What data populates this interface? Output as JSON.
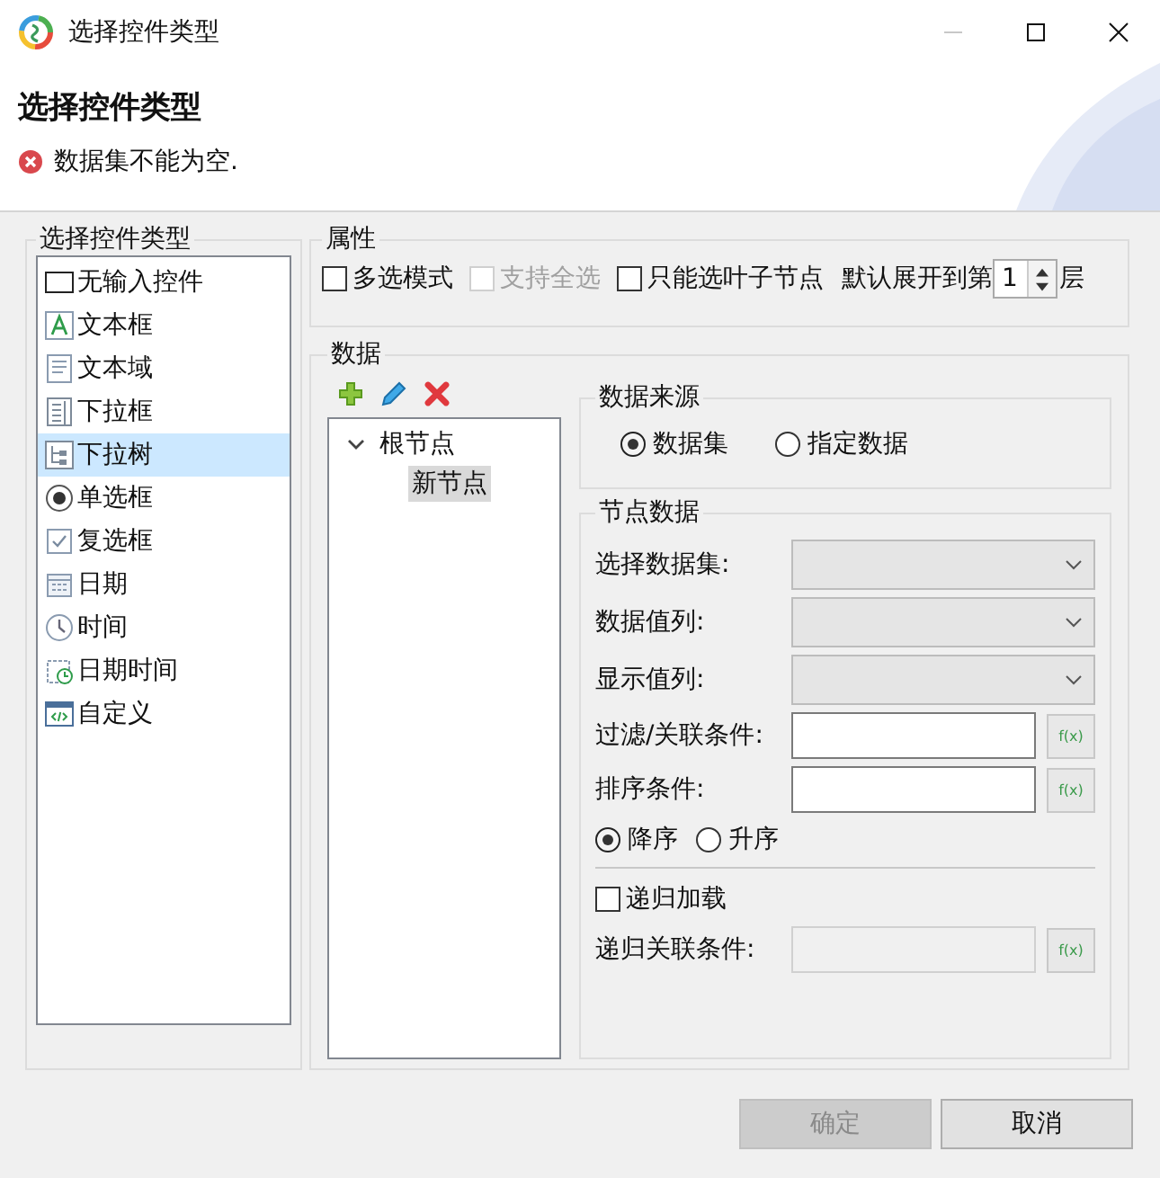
{
  "window": {
    "title": "选择控件类型",
    "buttons": [
      {
        "kind": "minimize",
        "disabled": true
      },
      {
        "kind": "maximize",
        "disabled": false
      },
      {
        "kind": "close",
        "disabled": false
      }
    ]
  },
  "header": {
    "title": "选择控件类型",
    "message": "数据集不能为空."
  },
  "control_types": {
    "title": "选择控件类型",
    "items": [
      {
        "label": "无输入控件",
        "kind": "none",
        "selected": false
      },
      {
        "label": "文本框",
        "kind": "textbox",
        "selected": false
      },
      {
        "label": "文本域",
        "kind": "textarea",
        "selected": false
      },
      {
        "label": "下拉框",
        "kind": "combo",
        "selected": false
      },
      {
        "label": "下拉树",
        "kind": "tree",
        "selected": true
      },
      {
        "label": "单选框",
        "kind": "radio",
        "selected": false
      },
      {
        "label": "复选框",
        "kind": "checkbox",
        "selected": false
      },
      {
        "label": "日期",
        "kind": "date",
        "selected": false
      },
      {
        "label": "时间",
        "kind": "time",
        "selected": false
      },
      {
        "label": "日期时间",
        "kind": "datetime",
        "selected": false
      },
      {
        "label": "自定义",
        "kind": "custom",
        "selected": false
      }
    ]
  },
  "properties": {
    "title": "属性",
    "options": [
      {
        "label": "多选模式",
        "checked": false,
        "disabled": false
      },
      {
        "label": "支持全选",
        "checked": false,
        "disabled": true
      },
      {
        "label": "只能选叶子节点",
        "checked": false,
        "disabled": false
      }
    ],
    "expand_label": "默认展开到第",
    "expand_value": "1",
    "expand_suffix": "层"
  },
  "data": {
    "title": "数据",
    "toolbar": [
      {
        "kind": "add"
      },
      {
        "kind": "edit"
      },
      {
        "kind": "delete"
      }
    ],
    "tree": [
      {
        "label": "根节点",
        "expanded": true,
        "selected": false,
        "children": [
          {
            "label": "新节点",
            "selected": true
          }
        ]
      }
    ],
    "source": {
      "title": "数据来源",
      "options": [
        {
          "label": "数据集",
          "selected": true
        },
        {
          "label": "指定数据",
          "selected": false
        }
      ]
    },
    "node_data": {
      "title": "节点数据",
      "fields": [
        {
          "label": "选择数据集:",
          "kind": "select"
        },
        {
          "label": "数据值列:",
          "kind": "select"
        },
        {
          "label": "显示值列:",
          "kind": "select"
        },
        {
          "label": "过滤/关联条件:",
          "kind": "text",
          "button": "f(x)"
        },
        {
          "label": "排序条件:",
          "kind": "text",
          "button": "f(x)"
        }
      ],
      "order": [
        {
          "label": "降序",
          "selected": true
        },
        {
          "label": "升序",
          "selected": false
        }
      ],
      "recursive": {
        "label": "递归加载",
        "checked": false
      },
      "recursive_field": {
        "label": "递归关联条件:",
        "disabled": true,
        "button": "f(x)"
      }
    }
  },
  "buttons": [
    {
      "label": "确定",
      "disabled": true
    },
    {
      "label": "取消",
      "disabled": false
    }
  ]
}
